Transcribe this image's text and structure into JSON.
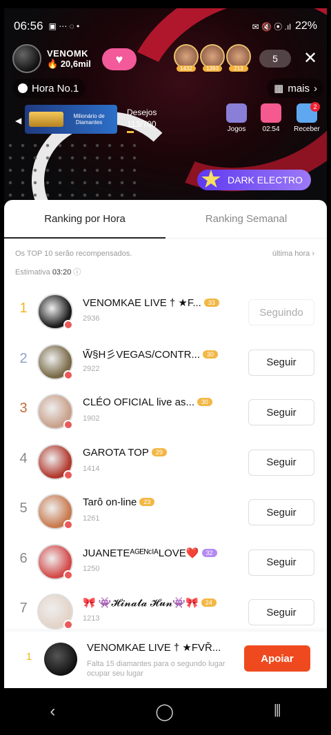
{
  "status": {
    "time": "06:56",
    "battery": "22%",
    "icons_left": "▣ ⋯ ◌ •",
    "icons_right": "✉ 🔇 ⦿ .ıl"
  },
  "host": {
    "name": "VENOMK",
    "count": "20,6mil"
  },
  "viewers": [
    {
      "tag": "1432"
    },
    {
      "tag": "1393"
    },
    {
      "tag": "213"
    }
  ],
  "viewer_count": "5",
  "hour_pill": "Hora No.1",
  "more_label": "mais",
  "banner": {
    "text": "Milionário de Diamantes"
  },
  "desejos": {
    "label": "Desejos",
    "value": "113/700"
  },
  "tools": [
    {
      "label": "Jogos",
      "color": "#8a7fd6"
    },
    {
      "label": "02:54",
      "color": "#f45a8f"
    },
    {
      "label": "Receber",
      "color": "#5fa8ef",
      "badge": "2"
    }
  ],
  "dark_electro": "DARK ELECTRO",
  "tabs": {
    "hourly": "Ranking por Hora",
    "weekly": "Ranking Semanal"
  },
  "info": {
    "top10": "Os TOP 10 serão recompensados.",
    "last_hour": "última hora",
    "estimate_label": "Estimativa",
    "estimate_value": "03:20"
  },
  "ranking": [
    {
      "rank": "1",
      "name": "VENOMKAE LIVE † ★F...",
      "level": "33",
      "score": "2936",
      "button": "Seguindo",
      "following": true,
      "avatar": "#1c1c1c"
    },
    {
      "rank": "2",
      "name": "W̃§H彡VEGAS/CONTR...",
      "level": "30",
      "score": "2922",
      "button": "Seguir",
      "following": false,
      "avatar": "#7a6b48"
    },
    {
      "rank": "3",
      "name": "CLÉO  OFICIAL    live as...",
      "level": "30",
      "score": "1902",
      "button": "Seguir",
      "following": false,
      "avatar": "#c9a18b"
    },
    {
      "rank": "4",
      "name": "GAROTA TOP",
      "level": "29",
      "score": "1414",
      "button": "Seguir",
      "following": false,
      "avatar": "#b23a2e"
    },
    {
      "rank": "5",
      "name": "Tarô on-line",
      "level": "23",
      "score": "1261",
      "button": "Seguir",
      "following": false,
      "avatar": "#c97a4e"
    },
    {
      "rank": "6",
      "name": "JUANETEᴬᴳᴱᴺᶜᴵᴬLOVE❤️",
      "level": "32",
      "level_style": "purple",
      "score": "1250",
      "button": "Seguir",
      "following": false,
      "avatar": "#d44a4a"
    },
    {
      "rank": "7",
      "name": "🎀 👾𝓗𝓲𝓷𝓪𝓽𝓪 𝓗𝓾𝓷👾🎀",
      "level": "24",
      "score": "1213",
      "button": "Seguir",
      "following": false,
      "avatar": "#e4d4c8"
    }
  ],
  "bottom": {
    "rank": "1",
    "name": "VENOMKAE LIVE † ★FVŘ...",
    "desc": "Falta 15 diamantes para o segundo lugar ocupar seu lugar",
    "button": "Apoiar"
  },
  "nav": {
    "back": "‹",
    "home": "◯",
    "recents": "⦀"
  }
}
